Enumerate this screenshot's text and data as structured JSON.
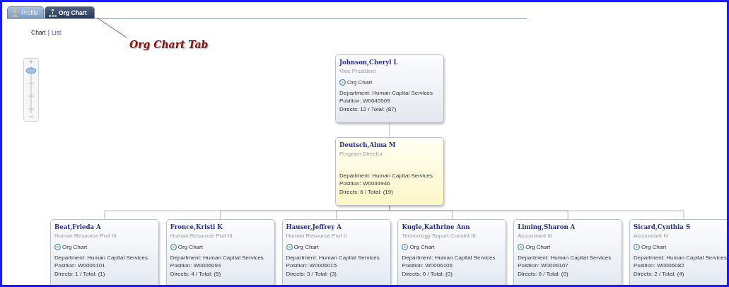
{
  "tabs": [
    {
      "label": "Profile",
      "kind": "profile",
      "selected": false
    },
    {
      "label": "Org Chart",
      "kind": "orgchart",
      "selected": true
    }
  ],
  "view_switch": [
    {
      "label": "Chart",
      "selected": true
    },
    {
      "label": "List",
      "selected": false
    }
  ],
  "view_separator": "|",
  "annotation": "Org Chart Tab",
  "org_chart": {
    "root": {
      "name": "Johnson,Cheryl L",
      "title": "Vice President",
      "link": "Org Chart",
      "department": "Department: Human Capital Services",
      "position": "Position: W0045509",
      "directs": "Directs: 12 / Total: (87)",
      "highlighted": false,
      "children": [
        {
          "name": "Deutsch,Alma M",
          "title": "Program Director",
          "department": "Department: Human Capital Services",
          "position": "Position: W0034946",
          "directs": "Directs: 6 / Total: (19)",
          "highlighted": true,
          "children": [
            {
              "name": "Beat,Frieda A",
              "title": "Human Resource Prof III",
              "link": "Org Chart",
              "department": "Department: Human Capital Services",
              "position": "Position: W0006101",
              "directs": "Directs: 1 / Total: (1)",
              "highlighted": false
            },
            {
              "name": "Fronce,Kristi K",
              "title": "Human Resource Prof III",
              "link": "Org Chart",
              "department": "Department: Human Capital Services",
              "position": "Position: W0006094",
              "directs": "Directs: 4 / Total: (5)",
              "highlighted": false
            },
            {
              "name": "Hauser,Jeffrey A",
              "title": "Human Resource Prof II",
              "link": "Org Chart",
              "department": "Department: Human Capital Services",
              "position": "Position: W0006015",
              "directs": "Directs: 3 / Total: (3)",
              "highlighted": false
            },
            {
              "name": "Kugle,Kathrine Ann",
              "title": "Technology Suport Conslnt III",
              "link": "Org Chart",
              "department": "Department: Human Capital Services",
              "position": "Position: W0006106",
              "directs": "Directs: 0 / Total: (0)",
              "highlighted": false
            },
            {
              "name": "Liming,Sharon A",
              "title": "Accountant III",
              "link": "Org Chart",
              "department": "Department: Human Capital Services",
              "position": "Position: W0006107",
              "directs": "Directs: 0 / Total: (0)",
              "highlighted": false
            },
            {
              "name": "Sicard,Cynthia S",
              "title": "Accountant IV",
              "link": "Org Chart",
              "department": "Department: Human Capital Services",
              "position": "Position: W0006082",
              "directs": "Directs: 2 / Total: (4)",
              "highlighted": false
            }
          ]
        }
      ]
    }
  }
}
